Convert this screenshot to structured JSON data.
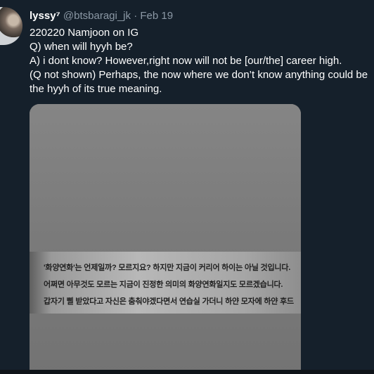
{
  "tweet": {
    "display_name": "lyssy⁷",
    "handle": "@btsbaragi_jk",
    "separator": "·",
    "date": "Feb 19",
    "lines": [
      "220220 Namjoon on IG",
      "Q) when will hyyh be?",
      "A) i dont know? However,right now will not be [our/the] career high.",
      "(Q not shown) Perhaps, the now where we don’t know anything could be",
      "the hyyh of its true meaning."
    ]
  },
  "scan": {
    "lines": [
      "'화양연화'는 언제일까? 모르지요? 하지만 지금이 커리어 하이는 아닐 것입니다.",
      "어쩌면 아무것도 모르는 지금이 진정한 의미의 화양연화일지도 모르겠습니다.",
      "갑자기 삘 받았다고 자신은 춤춰야겠다면서 연습실 가더니 하얀 모자에 하얀 후드"
    ]
  }
}
